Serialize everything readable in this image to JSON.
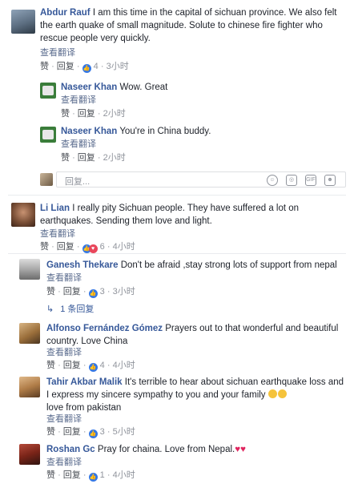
{
  "ui": {
    "translate": "查看翻译",
    "like": "赞",
    "reply": "回复",
    "dot": "·",
    "reply_placeholder": "回复...",
    "colors": {
      "link": "#365899",
      "like_icon": "#3578e5",
      "heart_icon": "#e9465b"
    }
  },
  "comments": [
    {
      "name": "Abdur Rauf",
      "text": "I am this time in the capital of sichuan province. We also felt the earth quake of small magnitude. Solute to chinese fire fighter who rescue people very quickly.",
      "likes": "4",
      "time": "3小时",
      "replies": [
        {
          "name": "Naseer Khan",
          "text": "Wow. Great",
          "time": "2小时"
        },
        {
          "name": "Naseer Khan",
          "text": "You're in China buddy.",
          "time": "2小时"
        }
      ]
    },
    {
      "name": "Li Lian",
      "text": "I really pity Sichuan people. They have suffered a lot on earthquakes. Sending them love and light.",
      "likes": "6",
      "time": "4小时",
      "replies": [
        {
          "name": "Ganesh Thekare",
          "text": "Don't be afraid ,stay strong lots of support from nepal",
          "likes": "3",
          "time": "3小时",
          "more_replies": "1 条回复"
        },
        {
          "name": "Alfonso Fernández Gómez",
          "text": "Prayers out to that wonderful and beautiful country. Love China",
          "likes": "4",
          "time": "4小时"
        },
        {
          "name": "Tahir Akbar Malik",
          "text": "It's terrible to hear about sichuan earthquake loss and I express my sincere sympathy to you and your family",
          "text2": "love from pakistan",
          "likes": "3",
          "time": "5小时"
        },
        {
          "name": "Roshan Gc",
          "text": "Pray for chaina. Love from Nepal.",
          "likes": "1",
          "time": "4小时"
        }
      ]
    }
  ]
}
